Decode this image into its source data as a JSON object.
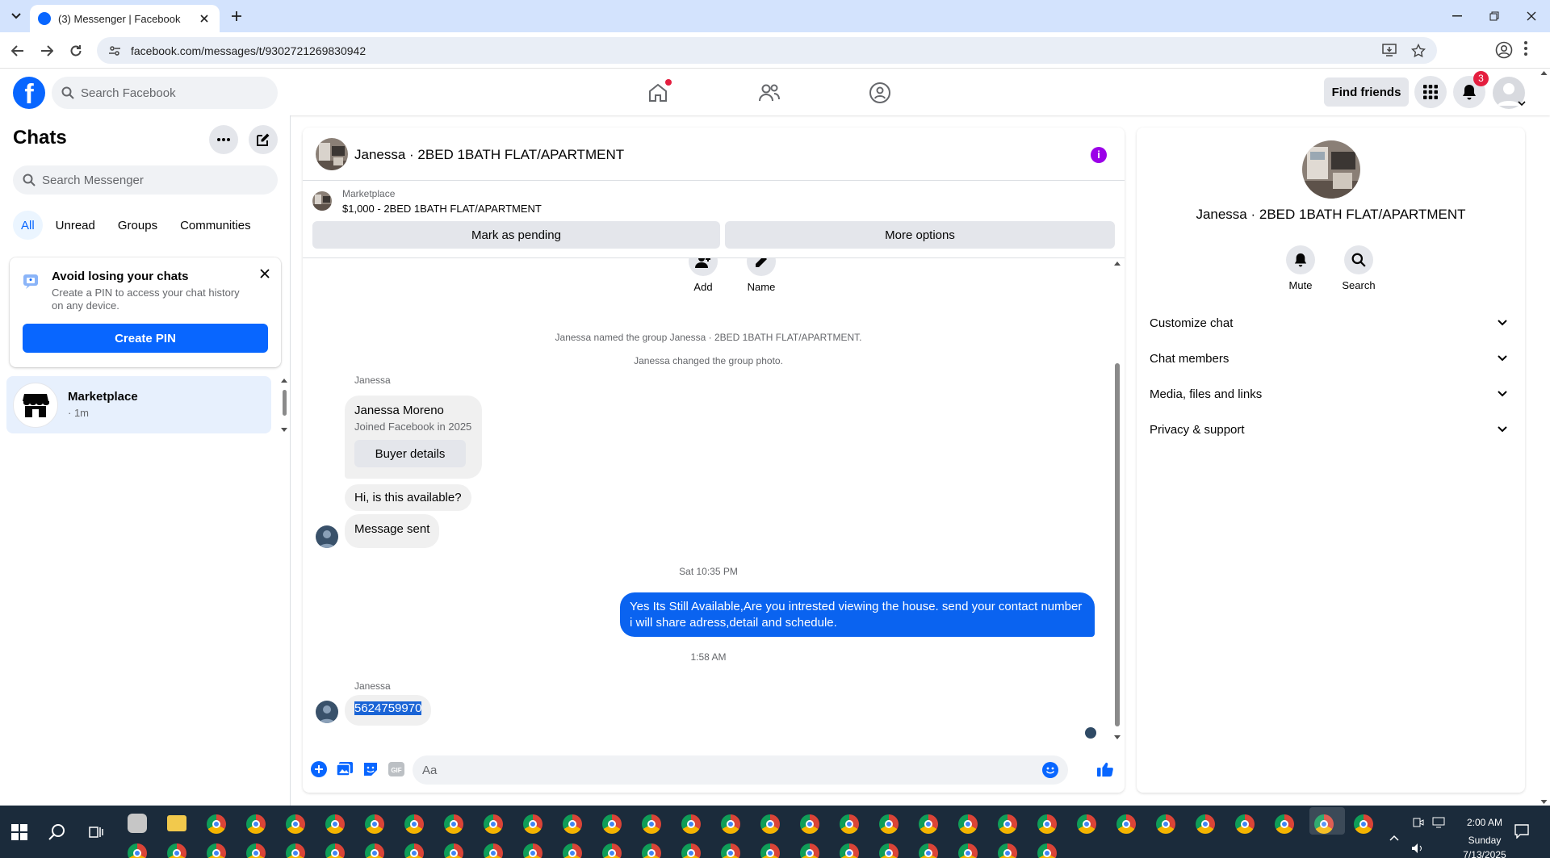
{
  "browser": {
    "tab_title": "(3) Messenger | Facebook",
    "url": "facebook.com/messages/t/9302721269830942"
  },
  "fb": {
    "search_placeholder": "Search Facebook",
    "find_friends": "Find friends",
    "notification_count": "3",
    "brand_color": "#0866ff"
  },
  "sidebar": {
    "title": "Chats",
    "search_placeholder": "Search Messenger",
    "filters": [
      "All",
      "Unread",
      "Groups",
      "Communities"
    ],
    "pin_card": {
      "title": "Avoid losing your chats",
      "description": "Create a PIN to access your chat history on any device.",
      "button": "Create PIN"
    },
    "chats": [
      {
        "name": "Marketplace",
        "time": "· 1m"
      }
    ]
  },
  "conversation": {
    "title": "Janessa · 2BED 1BATH FLAT/APARTMENT",
    "marketplace_label": "Marketplace",
    "listing": "$1,000 - 2BED 1BATH FLAT/APARTMENT",
    "mark_pending": "Mark as pending",
    "more_options": "More options",
    "add_label": "Add",
    "name_label": "Name",
    "system_messages": [
      "Janessa named the group Janessa · 2BED 1BATH FLAT/APARTMENT.",
      "Janessa changed the group photo."
    ],
    "sender_name": "Janessa",
    "buyer_card": {
      "name": "Janessa Moreno",
      "joined": "Joined Facebook in 2025",
      "button": "Buyer details"
    },
    "incoming_1": "Hi, is this available?",
    "incoming_2": "Message sent",
    "timestamp_1": "Sat 10:35 PM",
    "outgoing": "Yes Its Still Available,Are you intrested viewing the house. send your contact number i will share adress,detail and schedule.",
    "timestamp_2": "1:58 AM",
    "incoming_3": "5624759970",
    "composer_placeholder": "Aa",
    "accent_color": "#0a63f0"
  },
  "right_panel": {
    "title": "Janessa · 2BED 1BATH FLAT/APARTMENT",
    "mute": "Mute",
    "search": "Search",
    "sections": [
      "Customize chat",
      "Chat members",
      "Media, files and links",
      "Privacy & support"
    ]
  },
  "taskbar": {
    "time": "2:00 AM",
    "day": "Sunday",
    "date": "7/13/2025"
  }
}
